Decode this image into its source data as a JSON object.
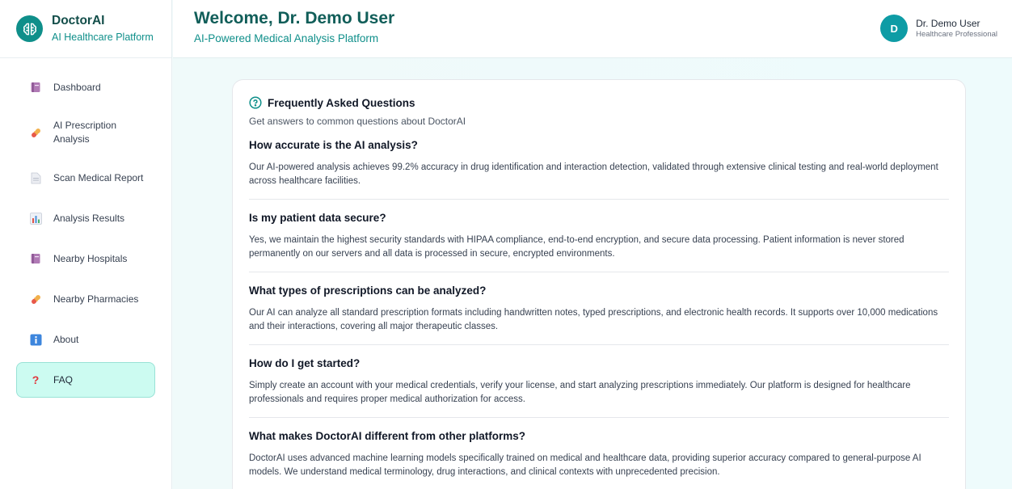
{
  "brand": {
    "name": "DoctorAI",
    "subtitle": "AI Healthcare Platform"
  },
  "sidebar": {
    "items": [
      {
        "label": "Dashboard",
        "icon": "book-icon",
        "active": false
      },
      {
        "label": "AI Prescription Analysis",
        "icon": "pill-icon",
        "active": false
      },
      {
        "label": "Scan Medical Report",
        "icon": "document-icon",
        "active": false
      },
      {
        "label": "Analysis Results",
        "icon": "bar-chart-icon",
        "active": false
      },
      {
        "label": "Nearby Hospitals",
        "icon": "book-icon",
        "active": false
      },
      {
        "label": "Nearby Pharmacies",
        "icon": "pill-icon",
        "active": false
      },
      {
        "label": "About",
        "icon": "info-icon",
        "active": false
      },
      {
        "label": "FAQ",
        "icon": "question-icon",
        "active": true
      }
    ]
  },
  "header": {
    "title": "Welcome, Dr. Demo User",
    "subtitle": "AI-Powered Medical Analysis Platform",
    "user": {
      "initial": "D",
      "name": "Dr. Demo User",
      "role": "Healthcare Professional"
    }
  },
  "faq": {
    "title": "Frequently Asked Questions",
    "subtitle": "Get answers to common questions about DoctorAI",
    "items": [
      {
        "question": "How accurate is the AI analysis?",
        "answer": "Our AI-powered analysis achieves 99.2% accuracy in drug identification and interaction detection, validated through extensive clinical testing and real-world deployment across healthcare facilities."
      },
      {
        "question": "Is my patient data secure?",
        "answer": "Yes, we maintain the highest security standards with HIPAA compliance, end-to-end encryption, and secure data processing. Patient information is never stored permanently on our servers and all data is processed in secure, encrypted environments."
      },
      {
        "question": "What types of prescriptions can be analyzed?",
        "answer": "Our AI can analyze all standard prescription formats including handwritten notes, typed prescriptions, and electronic health records. It supports over 10,000 medications and their interactions, covering all major therapeutic classes."
      },
      {
        "question": "How do I get started?",
        "answer": "Simply create an account with your medical credentials, verify your license, and start analyzing prescriptions immediately. Our platform is designed for healthcare professionals and requires proper medical authorization for access."
      },
      {
        "question": "What makes DoctorAI different from other platforms?",
        "answer": "DoctorAI uses advanced machine learning models specifically trained on medical and healthcare data, providing superior accuracy compared to general-purpose AI models. We understand medical terminology, drug interactions, and clinical contexts with unprecedented precision."
      }
    ]
  },
  "colors": {
    "brand": "#0f8f8a",
    "active_bg": "#ccfbf1",
    "heading": "#115e59"
  }
}
